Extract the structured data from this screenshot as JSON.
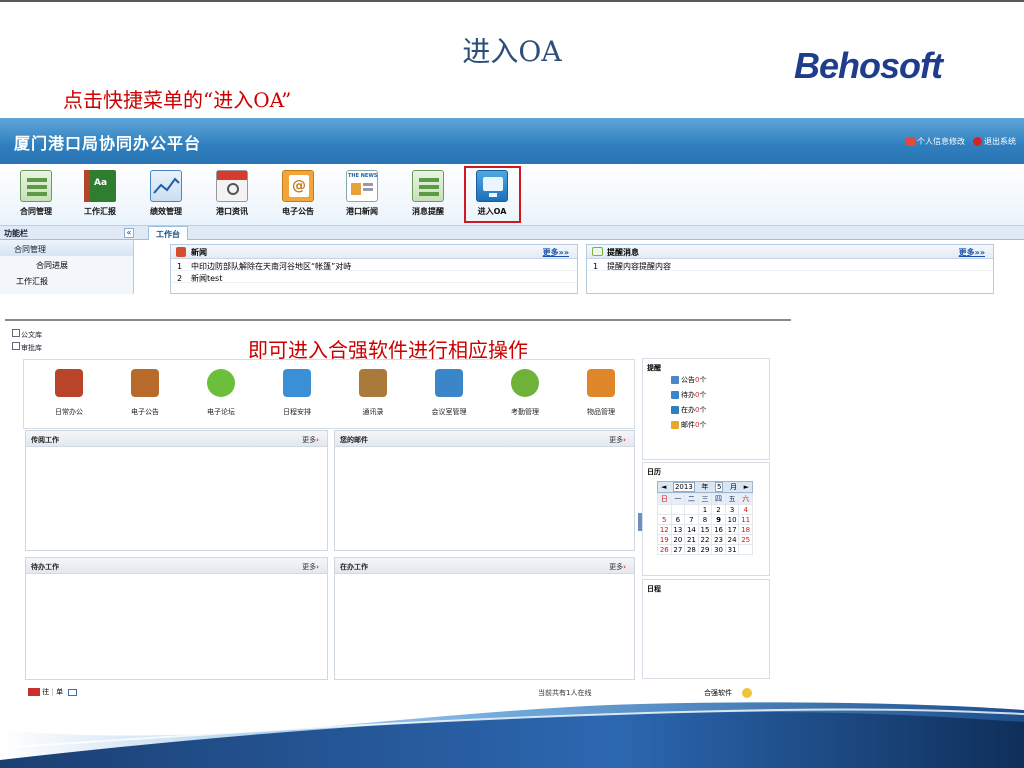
{
  "slide": {
    "title": "进入OA",
    "logo": "Behosoft",
    "caption1": "点击快捷菜单的“进入OA”",
    "caption2": "即可进入合强软件进行相应操作"
  },
  "oa_top": {
    "header_title": "厦门港口局协同办公平台",
    "header_links": [
      "个人信息修改",
      "退出系统"
    ],
    "toolbar": [
      {
        "label": "合同管理",
        "icon": "contract-icon"
      },
      {
        "label": "工作汇报",
        "icon": "work-report-icon"
      },
      {
        "label": "绩效管理",
        "icon": "performance-icon"
      },
      {
        "label": "港口资讯",
        "icon": "port-info-icon"
      },
      {
        "label": "电子公告",
        "icon": "announcement-icon"
      },
      {
        "label": "港口新闻",
        "icon": "port-news-icon"
      },
      {
        "label": "消息提醒",
        "icon": "message-remind-icon"
      },
      {
        "label": "进入OA",
        "icon": "enter-oa-icon"
      }
    ],
    "news_icon_text": "THE NEWS",
    "sidebar_title": "功能栏",
    "collapse": "«",
    "tab": "工作台",
    "sidebar_items": [
      {
        "label": "合同管理"
      },
      {
        "label": "合同进展"
      },
      {
        "label": "工作汇报"
      }
    ],
    "news_panel": {
      "title": "新闻",
      "more": "更多»»",
      "rows": [
        {
          "n": "1",
          "text": "中印边防部队解除在天南河谷地区“帐篷”对峙"
        },
        {
          "n": "2",
          "text": "新闻test"
        }
      ]
    },
    "remind_panel": {
      "title": "提醒消息",
      "more": "更多»»",
      "rows": [
        {
          "n": "1",
          "text": "提醒内容提醒内容"
        }
      ]
    }
  },
  "oa_app": {
    "library_links": [
      "公文库",
      "审批库"
    ],
    "apps": [
      {
        "label": "日常办公",
        "icon": "daily-office-icon",
        "color": "#b8452a"
      },
      {
        "label": "电子公告",
        "icon": "e-announcement-icon",
        "color": "#b76a2a"
      },
      {
        "label": "电子论坛",
        "icon": "forum-icon",
        "color": "#6cbf3a"
      },
      {
        "label": "日程安排",
        "icon": "schedule-icon",
        "color": "#3b8fd4"
      },
      {
        "label": "通讯录",
        "icon": "address-book-icon",
        "color": "#a97a3a"
      },
      {
        "label": "会议室管理",
        "icon": "meeting-room-icon",
        "color": "#3a86c9"
      },
      {
        "label": "考勤管理",
        "icon": "attendance-icon",
        "color": "#6fb23a"
      },
      {
        "label": "物品管理",
        "icon": "goods-icon",
        "color": "#e0862a"
      }
    ],
    "panels": [
      {
        "title": "传阅工作",
        "more": "更多"
      },
      {
        "title": "您的邮件",
        "more": "更多"
      },
      {
        "title": "待办工作",
        "more": "更多"
      },
      {
        "title": "在办工作",
        "more": "更多"
      }
    ],
    "remind": {
      "title": "提醒",
      "items": [
        {
          "label": "公告",
          "count": "0",
          "unit": "个"
        },
        {
          "label": "待办",
          "count": "0",
          "unit": "个"
        },
        {
          "label": "在办",
          "count": "0",
          "unit": "个"
        },
        {
          "label": "邮件",
          "count": "0",
          "unit": "个"
        }
      ]
    },
    "calendar": {
      "title": "日历",
      "prev": "◄",
      "next": "►",
      "year": "2013",
      "year_label": "年",
      "month": "5",
      "month_label": "月",
      "weekdays": [
        "日",
        "一",
        "二",
        "三",
        "四",
        "五",
        "六"
      ],
      "weeks": [
        [
          "",
          "",
          "",
          "1",
          "2",
          "3",
          "4"
        ],
        [
          "5",
          "6",
          "7",
          "8",
          "9",
          "10",
          "11"
        ],
        [
          "12",
          "13",
          "14",
          "15",
          "16",
          "17",
          "18"
        ],
        [
          "19",
          "20",
          "21",
          "22",
          "23",
          "24",
          "25"
        ],
        [
          "26",
          "27",
          "28",
          "29",
          "30",
          "31",
          ""
        ]
      ],
      "today": "9"
    },
    "schedule_title": "日程",
    "bottom_left": [
      "往",
      "单"
    ],
    "bottom_status": "当前共有1人在线",
    "bottom_brand": "合强软件"
  },
  "colors": {
    "title_blue": "#2b4f7a",
    "caption_red": "#cc0000",
    "oa_header": "#2f7fbf",
    "highlight_box": "#d0191e"
  }
}
